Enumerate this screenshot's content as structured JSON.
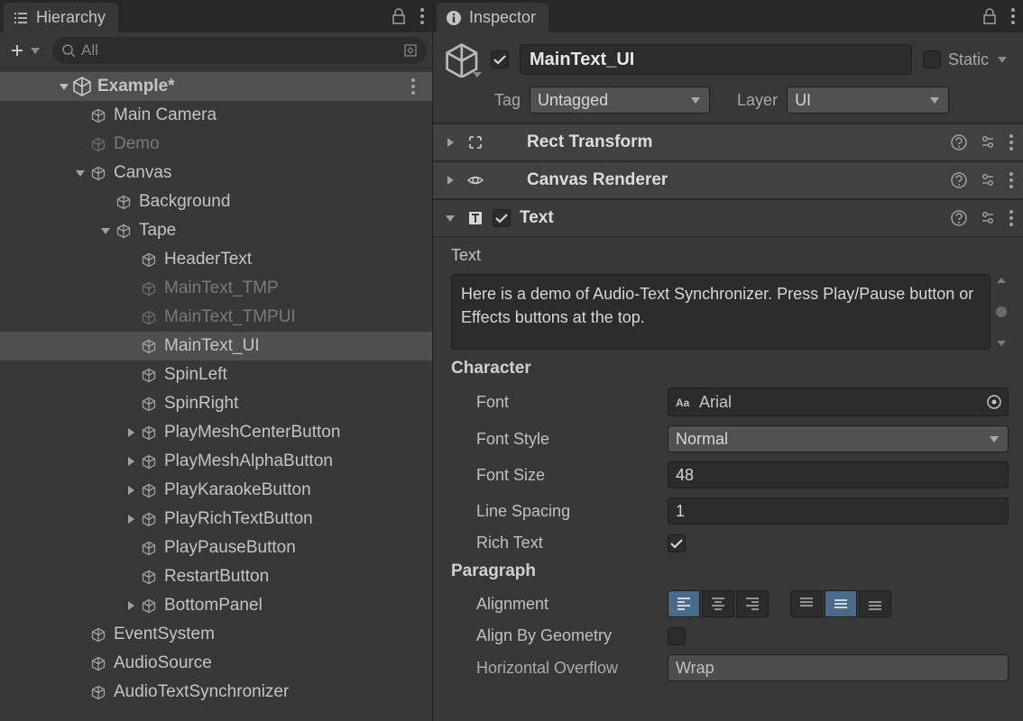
{
  "hierarchy": {
    "tab_title": "Hierarchy",
    "search_placeholder": "All",
    "scene_name": "Example*",
    "nodes": {
      "main_camera": "Main Camera",
      "demo": "Demo",
      "canvas": "Canvas",
      "background": "Background",
      "tape": "Tape",
      "header_text": "HeaderText",
      "main_text_tmp": "MainText_TMP",
      "main_text_tmpui": "MainText_TMPUI",
      "main_text_ui": "MainText_UI",
      "spin_left": "SpinLeft",
      "spin_right": "SpinRight",
      "play_mesh_center": "PlayMeshCenterButton",
      "play_mesh_alpha": "PlayMeshAlphaButton",
      "play_karaoke": "PlayKaraokeButton",
      "play_rich_text": "PlayRichTextButton",
      "play_pause": "PlayPauseButton",
      "restart": "RestartButton",
      "bottom_panel": "BottomPanel",
      "event_system": "EventSystem",
      "audio_source": "AudioSource",
      "audio_text_sync": "AudioTextSynchronizer"
    }
  },
  "inspector": {
    "tab_title": "Inspector",
    "object_name": "MainText_UI",
    "static_label": "Static",
    "tag_label": "Tag",
    "tag_value": "Untagged",
    "layer_label": "Layer",
    "layer_value": "UI",
    "components": {
      "rect_transform": "Rect Transform",
      "canvas_renderer": "Canvas Renderer",
      "text": "Text"
    },
    "text_comp": {
      "text_label": "Text",
      "text_value": "Here is a demo of Audio-Text Synchronizer. Press Play/Pause button or Effects buttons at the top.",
      "character_heading": "Character",
      "font_label": "Font",
      "font_value": "Arial",
      "font_style_label": "Font Style",
      "font_style_value": "Normal",
      "font_size_label": "Font Size",
      "font_size_value": "48",
      "line_spacing_label": "Line Spacing",
      "line_spacing_value": "1",
      "rich_text_label": "Rich Text",
      "paragraph_heading": "Paragraph",
      "alignment_label": "Alignment",
      "align_by_geometry_label": "Align By Geometry",
      "h_overflow_label": "Horizontal Overflow",
      "h_overflow_value": "Wrap"
    }
  }
}
